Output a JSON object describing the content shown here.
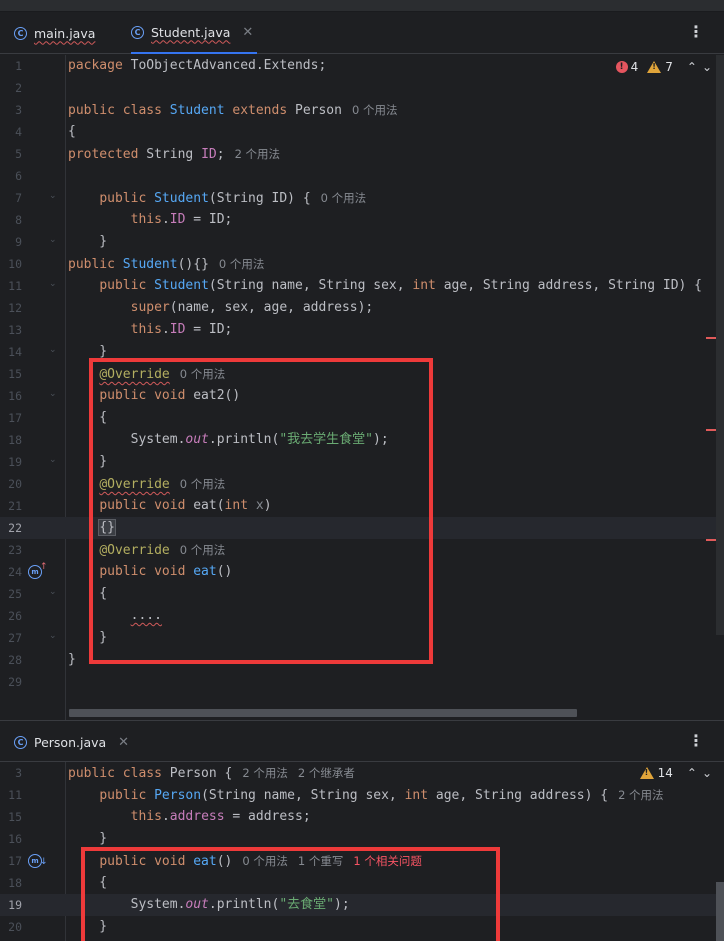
{
  "top_tabs": [
    {
      "label": "main.java",
      "active": false
    },
    {
      "label": "Student.java",
      "active": true
    }
  ],
  "top_inspection": {
    "errors": "4",
    "warnings": "7",
    "up": "⌃",
    "down": "⌄"
  },
  "top_lines": [
    {
      "n": "1",
      "tokens": [
        [
          "kw",
          "package "
        ],
        [
          "",
          "ToObjectAdvanced.Extends;"
        ]
      ]
    },
    {
      "n": "2",
      "tokens": []
    },
    {
      "n": "3",
      "tokens": [
        [
          "kw",
          "public class "
        ],
        [
          "fn",
          "Student "
        ],
        [
          "kw",
          "extends "
        ],
        [
          "",
          "Person"
        ],
        [
          "hint",
          "0 个用法"
        ]
      ]
    },
    {
      "n": "4",
      "tokens": [
        [
          "",
          "{"
        ]
      ]
    },
    {
      "n": "5",
      "tokens": [
        [
          "kw",
          "protected "
        ],
        [
          "",
          "String "
        ],
        [
          "tp",
          "ID"
        ],
        [
          "",
          ";"
        ],
        [
          "hint",
          "2 个用法"
        ]
      ]
    },
    {
      "n": "6",
      "tokens": []
    },
    {
      "n": "7",
      "tokens": [
        [
          "",
          "    "
        ],
        [
          "kw",
          "public "
        ],
        [
          "fn",
          "Student"
        ],
        [
          "",
          "(String ID) {"
        ],
        [
          "hint",
          "0 个用法"
        ]
      ]
    },
    {
      "n": "8",
      "tokens": [
        [
          "",
          "        "
        ],
        [
          "kw",
          "this"
        ],
        [
          "",
          "."
        ],
        [
          "tp",
          "ID"
        ],
        [
          "",
          " = ID;"
        ]
      ]
    },
    {
      "n": "9",
      "tokens": [
        [
          "",
          "    }"
        ]
      ]
    },
    {
      "n": "10",
      "tokens": [
        [
          "kw",
          "public "
        ],
        [
          "fn",
          "Student"
        ],
        [
          "",
          "(){}"
        ],
        [
          "hint",
          "0 个用法"
        ]
      ]
    },
    {
      "n": "11",
      "tokens": [
        [
          "",
          "    "
        ],
        [
          "kw",
          "public "
        ],
        [
          "fn",
          "Student"
        ],
        [
          "",
          "(String name, String sex, "
        ],
        [
          "kw",
          "int "
        ],
        [
          "",
          "age, String address, String ID) {"
        ]
      ]
    },
    {
      "n": "12",
      "tokens": [
        [
          "",
          "        "
        ],
        [
          "kw",
          "super"
        ],
        [
          "",
          "(name, sex, age, address);"
        ]
      ]
    },
    {
      "n": "13",
      "tokens": [
        [
          "",
          "        "
        ],
        [
          "kw",
          "this"
        ],
        [
          "",
          "."
        ],
        [
          "tp",
          "ID"
        ],
        [
          "",
          " = ID;"
        ]
      ]
    },
    {
      "n": "14",
      "tokens": [
        [
          "",
          "    }"
        ]
      ]
    },
    {
      "n": "15",
      "tokens": [
        [
          "",
          "    "
        ],
        [
          "anq",
          "@Override"
        ],
        [
          "hint",
          "0 个用法"
        ]
      ]
    },
    {
      "n": "16",
      "tokens": [
        [
          "",
          "    "
        ],
        [
          "kw",
          "public void "
        ],
        [
          "",
          "eat2()"
        ]
      ]
    },
    {
      "n": "17",
      "tokens": [
        [
          "",
          "    {"
        ]
      ]
    },
    {
      "n": "18",
      "tokens": [
        [
          "",
          "        System."
        ],
        [
          "it",
          "out"
        ],
        [
          "",
          ".println("
        ],
        [
          "st",
          "\"我去学生食堂\""
        ],
        [
          "",
          ");"
        ]
      ]
    },
    {
      "n": "19",
      "tokens": [
        [
          "",
          "    }"
        ]
      ]
    },
    {
      "n": "20",
      "tokens": [
        [
          "",
          "    "
        ],
        [
          "anq",
          "@Override"
        ],
        [
          "hint",
          "0 个用法"
        ]
      ]
    },
    {
      "n": "21",
      "tokens": [
        [
          "",
          "    "
        ],
        [
          "kw",
          "public void "
        ],
        [
          "",
          "eat("
        ],
        [
          "kw",
          "int "
        ],
        [
          "pm",
          "x"
        ],
        [
          "",
          ")"
        ]
      ]
    },
    {
      "n": "22",
      "tokens": [
        [
          "",
          "    "
        ],
        [
          "brk",
          "{}"
        ]
      ]
    },
    {
      "n": "23",
      "tokens": [
        [
          "",
          "    "
        ],
        [
          "an",
          "@Override"
        ],
        [
          "hint",
          "0 个用法"
        ]
      ]
    },
    {
      "n": "24",
      "tokens": [
        [
          "",
          "    "
        ],
        [
          "kw",
          "public void "
        ],
        [
          "fn",
          "eat"
        ],
        [
          "",
          "()"
        ]
      ]
    },
    {
      "n": "25",
      "tokens": [
        [
          "",
          "    {"
        ]
      ]
    },
    {
      "n": "26",
      "tokens": [
        [
          "",
          "        "
        ],
        [
          "sq",
          "...."
        ]
      ]
    },
    {
      "n": "27",
      "tokens": [
        [
          "",
          "    }"
        ]
      ]
    },
    {
      "n": "28",
      "tokens": [
        [
          "",
          "}"
        ]
      ]
    },
    {
      "n": "29",
      "tokens": []
    }
  ],
  "bottom_tabs": [
    {
      "label": "Person.java",
      "active": false
    }
  ],
  "bottom_inspection": {
    "warnings": "14",
    "up": "⌃",
    "down": "⌄"
  },
  "bottom_lines": [
    {
      "n": "3",
      "tokens": [
        [
          "kw",
          "public class "
        ],
        [
          "",
          "Person {"
        ],
        [
          "hint",
          "2 个用法"
        ],
        [
          "hint",
          "2 个继承者"
        ]
      ]
    },
    {
      "n": "11",
      "tokens": [
        [
          "",
          "    "
        ],
        [
          "kw",
          "public "
        ],
        [
          "fn",
          "Person"
        ],
        [
          "",
          "(String name, String sex, "
        ],
        [
          "kw",
          "int "
        ],
        [
          "",
          "age, String address) {"
        ],
        [
          "hint",
          "2 个用法"
        ]
      ]
    },
    {
      "n": "15",
      "tokens": [
        [
          "",
          "        "
        ],
        [
          "kw",
          "this"
        ],
        [
          "",
          "."
        ],
        [
          "tp",
          "address"
        ],
        [
          "",
          " = address;"
        ]
      ]
    },
    {
      "n": "16",
      "tokens": [
        [
          "",
          "    }"
        ]
      ]
    },
    {
      "n": "17",
      "tokens": [
        [
          "",
          "    "
        ],
        [
          "kw",
          "public void "
        ],
        [
          "fn",
          "eat"
        ],
        [
          "",
          "()"
        ],
        [
          "hint",
          "0 个用法"
        ],
        [
          "hint",
          "1 个重写"
        ],
        [
          "hinterr",
          "1 个相关问题"
        ]
      ]
    },
    {
      "n": "18",
      "tokens": [
        [
          "",
          "    {"
        ]
      ]
    },
    {
      "n": "19",
      "tokens": [
        [
          "",
          "        System."
        ],
        [
          "it",
          "out"
        ],
        [
          "",
          ".println("
        ],
        [
          "st",
          "\"去食堂\""
        ],
        [
          "",
          ");"
        ]
      ]
    },
    {
      "n": "20",
      "tokens": [
        [
          "",
          "    }"
        ]
      ]
    }
  ],
  "colors": {
    "highlight_box": "#ee3a3a",
    "accent": "#3574f0"
  }
}
